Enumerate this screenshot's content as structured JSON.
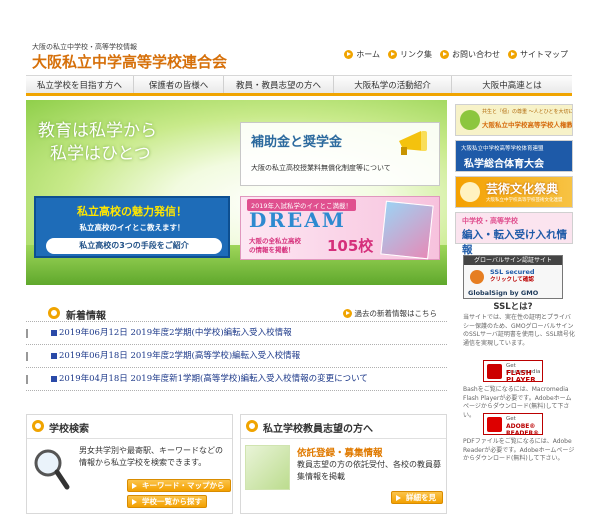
{
  "header": {
    "tagline": "大阪の私立中学校・高等学校情報",
    "title": "大阪私立中学高等学校連合会",
    "links": [
      {
        "label": "ホーム"
      },
      {
        "label": "リンク集"
      },
      {
        "label": "お問い合わせ"
      },
      {
        "label": "サイトマップ"
      }
    ]
  },
  "nav": {
    "items": [
      {
        "label": "私立学校を目指す方へ"
      },
      {
        "label": "保護者の皆様へ"
      },
      {
        "label": "教員・教員志望の方へ"
      },
      {
        "label": "大阪私学の活動紹介"
      },
      {
        "label": "大阪中高連とは"
      }
    ]
  },
  "hero": {
    "copy_line1": "教育は私学から",
    "copy_line2": "私学はひとつ",
    "subsidy_title": "補助金と奨学金",
    "subsidy_sub": "大阪の私立高校授業料無償化制度等について",
    "appeal_title": "私立高校の魅力発信！",
    "appeal_line": "私立高校のイイとこ教えます！",
    "appeal_line2": "私立高校の3つの手段をご紹介",
    "dream_head": "2019年入試私学のイイとこ満載！",
    "dream_word": "DREAM",
    "dream_sub1": "大阪の全私立高校",
    "dream_sub2": "の情報を掲載！",
    "dream_num": "105校"
  },
  "sidebar": {
    "banners": [
      {
        "line1": "共生と『個』の尊重 〜人とひとを大切に〜",
        "line2": "大阪私立中学校高等学校人権教育研究会"
      },
      {
        "line1": "大阪私立中学校高等学校体育連盟",
        "line2": "私学総合体育大会"
      },
      {
        "line1": "大阪私立中学校高等学校芸術文化連盟",
        "line2": "芸術文化祭典"
      },
      {
        "line1": "中学校・高等学校",
        "line2": "編入・転入受け入れ情報"
      }
    ],
    "ssl": {
      "head": "グローバルサイン認証サイト",
      "text1": "SSL secured",
      "text2": "クリックして確認",
      "brand": "GlobalSign by GMO",
      "what": "SSLとは?",
      "desc": "当サイトでは、実在性の証明とプライバシー保護のため、GMOグローバルサインのSSLサーバ証明書を使用し、SSL暗号化通信を実現しています。"
    },
    "flash": {
      "small": "Get macromedia",
      "big": "FLASH PLAYER",
      "desc": "Bashをご覧になるには、Macromedia Flash Playerが必要です。Adobeホームページからダウンロード(無料)して下さい。"
    },
    "reader": {
      "small": "Get",
      "big": "ADOBE® READER®",
      "desc": "PDFファイルをご覧になるには、Adobe Readerが必要です。Adobeホームページからダウンロード(無料)して下さい。"
    }
  },
  "news": {
    "title": "新着情報",
    "past_label": "過去の新着情報はこちら",
    "items": [
      {
        "text": "2019年06月12日 2019年度2学期(中学校)編転入受入校情報"
      },
      {
        "text": "2019年06月18日 2019年度2学期(高等学校)編転入受入校情報"
      },
      {
        "text": "2019年04月18日 2019年度新1学期(高等学校)編転入受入校情報の変更について"
      }
    ]
  },
  "school_search": {
    "title": "学校検索",
    "text": "男女共学別や最寄駅、キーワードなどの情報から私立学校を検索できます。",
    "btn_keyword": "キーワード・マップから探す",
    "btn_list": "学校一覧から探す"
  },
  "teacher": {
    "title": "私立学校教員志望の方へ",
    "subtitle": "依託登録・募集情報",
    "text": "教員志望の方の依託受付、各校の教員募集情報を掲載",
    "btn": "詳細を見る"
  }
}
